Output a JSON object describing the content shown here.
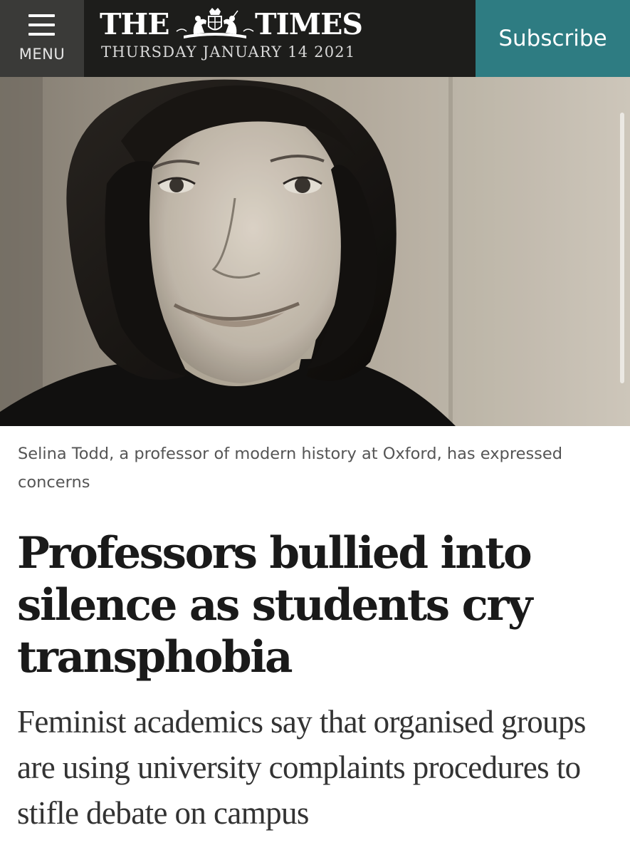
{
  "header": {
    "menu_label": "MENU",
    "masthead_left": "THE",
    "masthead_right": "TIMES",
    "date": "THURSDAY JANUARY 14 2021",
    "subscribe_label": "Subscribe",
    "background": "#1d1d1b",
    "menu_background": "#3a3a38",
    "subscribe_background": "#2e7c82"
  },
  "icons": {
    "menu": "hamburger-icon",
    "crest": "royal-crest-logo"
  },
  "hero_image": {
    "description_role": "black-and-white portrait photograph"
  },
  "article": {
    "caption": "Selina Todd, a professor of modern history at Oxford, has expressed concerns",
    "headline": "Professors bullied into silence as students cry transphobia",
    "standfirst": "Feminist academics say that organised groups are using university complaints procedures to stifle debate on campus"
  }
}
